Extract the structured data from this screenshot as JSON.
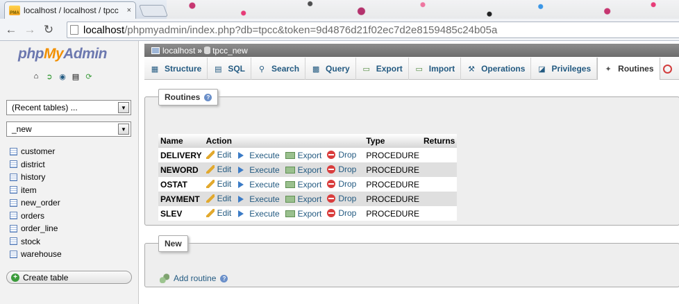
{
  "browser": {
    "tab_icon_text": "PMA",
    "tab_title": "localhost / localhost / tpcc",
    "tab_close": "×",
    "url_host": "localhost",
    "url_rest": "/phpmyadmin/index.php?db=tpcc&token=9d4876d21f02ec7d2e8159485c24b05a"
  },
  "sidebar": {
    "logo_php": "php",
    "logo_my": "My",
    "logo_admin": "Admin",
    "recent_select": "(Recent tables) ...",
    "db_select": "_new",
    "tables": [
      "customer",
      "district",
      "history",
      "item",
      "new_order",
      "orders",
      "order_line",
      "stock",
      "warehouse"
    ],
    "create_table": "Create table"
  },
  "breadcrumb": {
    "server": "localhost",
    "separator": "»",
    "database": "tpcc_new"
  },
  "tabs": [
    "Structure",
    "SQL",
    "Search",
    "Query",
    "Export",
    "Import",
    "Operations",
    "Privileges",
    "Routines"
  ],
  "active_tab": "Routines",
  "routines_panel": {
    "legend": "Routines",
    "headers": [
      "Name",
      "Action",
      "Type",
      "Returns"
    ],
    "actions": [
      "Edit",
      "Execute",
      "Export",
      "Drop"
    ],
    "rows": [
      {
        "name": "DELIVERY",
        "type": "PROCEDURE",
        "returns": ""
      },
      {
        "name": "NEWORD",
        "type": "PROCEDURE",
        "returns": ""
      },
      {
        "name": "OSTAT",
        "type": "PROCEDURE",
        "returns": ""
      },
      {
        "name": "PAYMENT",
        "type": "PROCEDURE",
        "returns": ""
      },
      {
        "name": "SLEV",
        "type": "PROCEDURE",
        "returns": ""
      }
    ]
  },
  "new_panel": {
    "legend": "New",
    "add_routine": "Add routine"
  }
}
